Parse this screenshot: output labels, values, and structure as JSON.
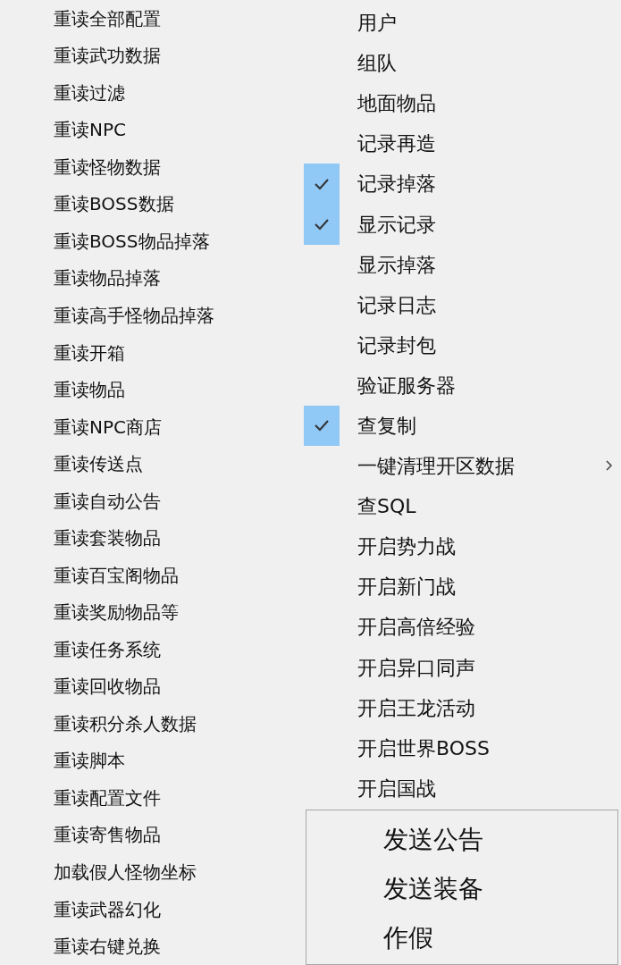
{
  "left_menu": {
    "items": [
      {
        "label": "重读全部配置"
      },
      {
        "label": "重读武功数据"
      },
      {
        "label": "重读过滤"
      },
      {
        "label": "重读NPC"
      },
      {
        "label": "重读怪物数据"
      },
      {
        "label": "重读BOSS数据"
      },
      {
        "label": "重读BOSS物品掉落"
      },
      {
        "label": "重读物品掉落"
      },
      {
        "label": "重读高手怪物品掉落"
      },
      {
        "label": "重读开箱"
      },
      {
        "label": "重读物品"
      },
      {
        "label": "重读NPC商店"
      },
      {
        "label": "重读传送点"
      },
      {
        "label": "重读自动公告"
      },
      {
        "label": "重读套装物品"
      },
      {
        "label": "重读百宝阁物品"
      },
      {
        "label": "重读奖励物品等"
      },
      {
        "label": "重读任务系统"
      },
      {
        "label": "重读回收物品"
      },
      {
        "label": "重读积分杀人数据"
      },
      {
        "label": "重读脚本"
      },
      {
        "label": "重读配置文件"
      },
      {
        "label": "重读寄售物品"
      },
      {
        "label": "加载假人怪物坐标"
      },
      {
        "label": "重读武器幻化"
      },
      {
        "label": "重读右键兑换"
      }
    ]
  },
  "right_menu": {
    "items": [
      {
        "label": "用户",
        "checked": false,
        "submenu": false
      },
      {
        "label": "组队",
        "checked": false,
        "submenu": false
      },
      {
        "label": "地面物品",
        "checked": false,
        "submenu": false
      },
      {
        "label": "记录再造",
        "checked": false,
        "submenu": false
      },
      {
        "label": "记录掉落",
        "checked": true,
        "submenu": false
      },
      {
        "label": "显示记录",
        "checked": true,
        "submenu": false
      },
      {
        "label": "显示掉落",
        "checked": false,
        "submenu": false
      },
      {
        "label": "记录日志",
        "checked": false,
        "submenu": false
      },
      {
        "label": "记录封包",
        "checked": false,
        "submenu": false
      },
      {
        "label": "验证服务器",
        "checked": false,
        "submenu": false
      },
      {
        "label": "查复制",
        "checked": true,
        "submenu": false
      },
      {
        "label": "一键清理开区数据",
        "checked": false,
        "submenu": true
      },
      {
        "label": "查SQL",
        "checked": false,
        "submenu": false
      },
      {
        "label": "开启势力战",
        "checked": false,
        "submenu": false
      },
      {
        "label": "开启新门战",
        "checked": false,
        "submenu": false
      },
      {
        "label": "开启高倍经验",
        "checked": false,
        "submenu": false
      },
      {
        "label": "开启异口同声",
        "checked": false,
        "submenu": false
      },
      {
        "label": "开启王龙活动",
        "checked": false,
        "submenu": false
      },
      {
        "label": "开启世界BOSS",
        "checked": false,
        "submenu": false
      },
      {
        "label": "开启国战",
        "checked": false,
        "submenu": false
      }
    ]
  },
  "bottom_menu": {
    "items": [
      {
        "label": "发送公告"
      },
      {
        "label": "发送装备"
      },
      {
        "label": "作假"
      }
    ]
  }
}
